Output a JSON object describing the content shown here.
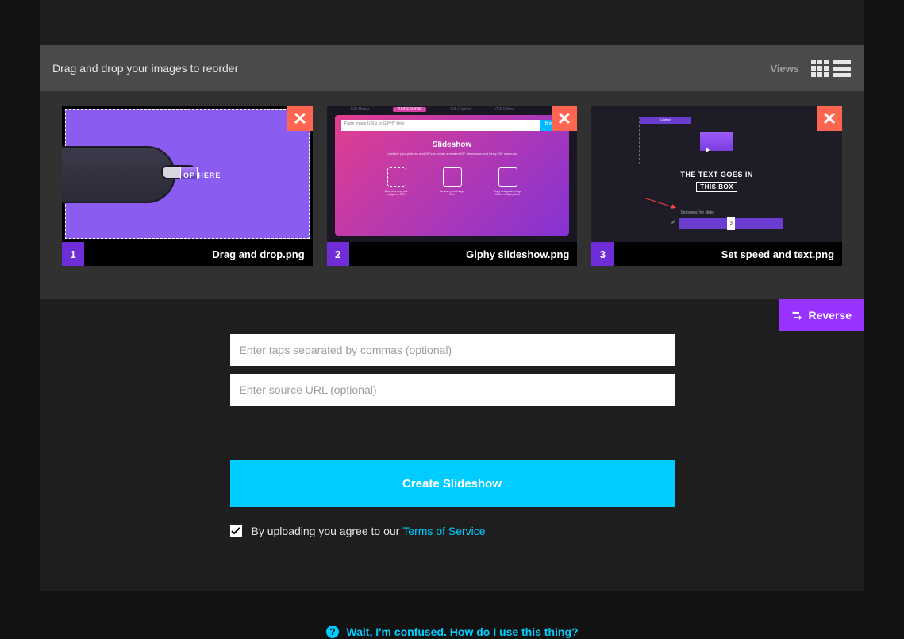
{
  "toolbar": {
    "instruction": "Drag and drop your images to reorder",
    "views_label": "Views"
  },
  "thumbnails": [
    {
      "num": "1",
      "name": "Drag and drop.png",
      "inner_text": "OP       HERE"
    },
    {
      "num": "2",
      "name": "Giphy slideshow.png",
      "nav_active": "SLIDESHOW",
      "url_placeholder": "Paste image URLs or GIPHY links",
      "url_btn": "Browse",
      "title": "Slideshow",
      "subtitle": "Combine your pictures and GIFs to create animated GIF slideshows and funny GIF mashups.",
      "icon_caps": [
        "Drag and drop with images or GIFs",
        "Browse your image files",
        "Copy and paste image URLs or Giphy links"
      ]
    },
    {
      "num": "3",
      "name": "Set speed and text.png",
      "tab_on": "Caption",
      "line1": "THE TEXT GOES IN",
      "line2": "THIS BOX",
      "slider_label": "Set speed for slide",
      "slider_val": "3",
      "mode": "gif"
    }
  ],
  "actions": {
    "reverse": "Reverse"
  },
  "form": {
    "tags_placeholder": "Enter tags separated by commas (optional)",
    "source_placeholder": "Enter source URL (optional)",
    "create_btn": "Create Slideshow",
    "tos_prefix": "By uploading you agree to our",
    "tos_link": "Terms of Service"
  },
  "help": {
    "text": "Wait, I'm confused. How do I use this thing?"
  }
}
